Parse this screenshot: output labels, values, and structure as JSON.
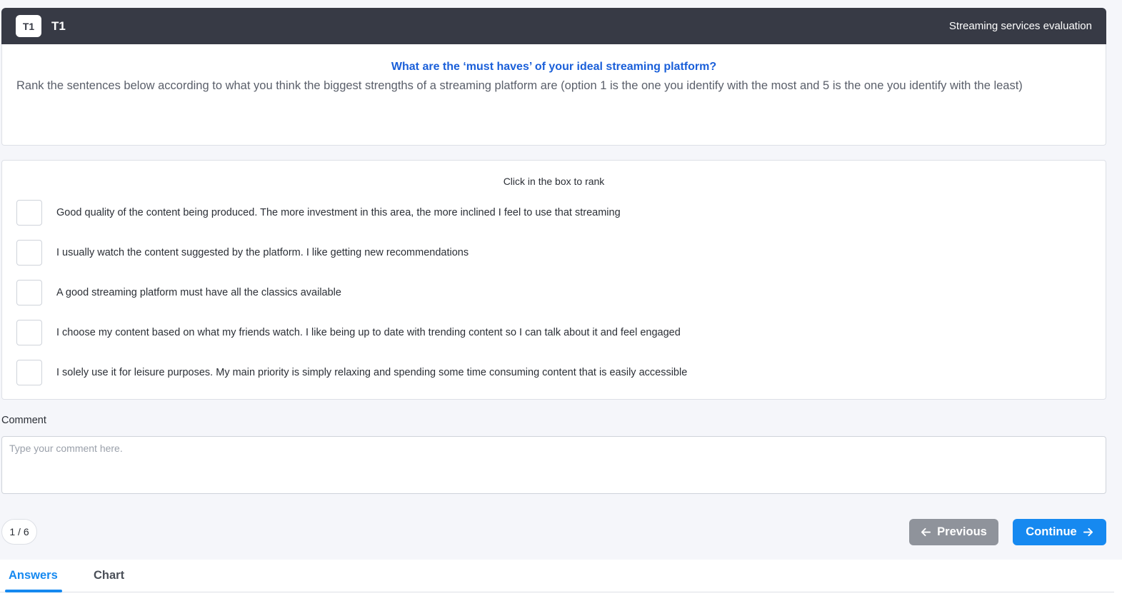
{
  "header": {
    "avatar_text": "T1",
    "title": "T1",
    "survey_name": "Streaming services evaluation"
  },
  "question": {
    "title": "What are the ‘must haves’ of your ideal streaming platform?",
    "instructions": "Rank the sentences below according to what you think the biggest strengths of a streaming platform are (option 1 is the one you identify with the most and 5 is the one you identify with the least)"
  },
  "ranking": {
    "hint": "Click in the box to rank",
    "options": [
      "Good quality of the content being produced. The more investment in this area, the more inclined I feel to use that streaming",
      "I usually watch the content suggested by the platform. I like getting new recommendations",
      "A good streaming platform must have all the classics available",
      "I choose my content based on what my friends watch. I like being up to date with trending content so I can talk about it and feel engaged",
      "I solely use it for leisure purposes. My main priority is simply relaxing and spending some time consuming content that is easily accessible"
    ]
  },
  "comment": {
    "label": "Comment",
    "placeholder": "Type your comment here.",
    "value": ""
  },
  "pagination": {
    "indicator": "1 / 6"
  },
  "buttons": {
    "previous_label": "Previous",
    "continue_label": "Continue"
  },
  "tabs": {
    "answers_label": "Answers",
    "chart_label": "Chart",
    "active": "Answers"
  },
  "colors": {
    "header_bg": "#373a45",
    "question_title": "#1a5fd9",
    "primary": "#1689f0",
    "disabled_button": "#8f939b"
  },
  "icons": {
    "previous": "arrow-left-icon",
    "continue": "arrow-right-icon"
  }
}
